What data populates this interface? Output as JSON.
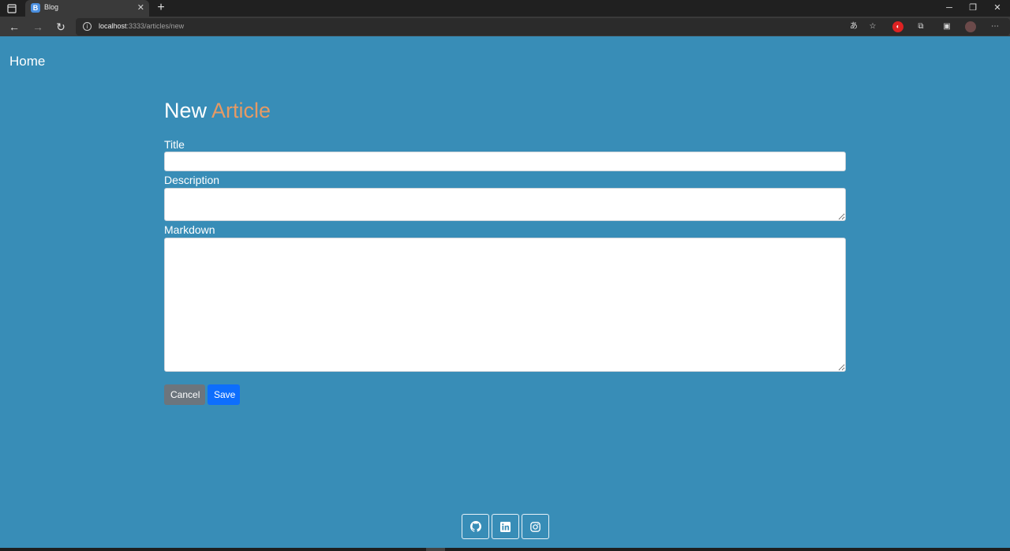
{
  "browser": {
    "tab_title": "Blog",
    "tab_favicon": "B",
    "url_host": "localhost",
    "url_path": ":3333/articles/new"
  },
  "nav": {
    "home_label": "Home"
  },
  "form": {
    "heading_main": "New",
    "heading_accent": "Article",
    "title_label": "Title",
    "title_value": "",
    "description_label": "Description",
    "description_value": "",
    "markdown_label": "Markdown",
    "markdown_value": "",
    "cancel_label": "Cancel",
    "save_label": "Save"
  },
  "footer": {
    "icons": [
      "github-icon",
      "linkedin-icon",
      "instagram-icon"
    ]
  },
  "colors": {
    "page_background": "#388db7",
    "accent": "#e69a64",
    "save_button": "#0d6efd",
    "cancel_button": "#6c757d"
  }
}
